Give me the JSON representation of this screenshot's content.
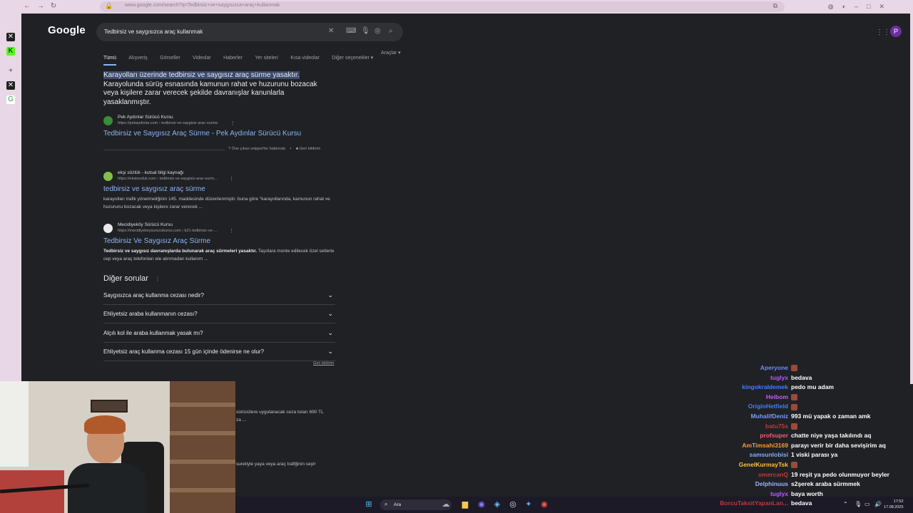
{
  "browser": {
    "url": "www.google.com/search?q=Tedbirsiz+ve+saygısızca+araç+kullanmak"
  },
  "google": {
    "logo": "Google",
    "query": "Tedbirsiz ve saygısızca araç kullanmak",
    "tabs": [
      "Tümü",
      "Alışveriş",
      "Görseller",
      "Videolar",
      "Haberler",
      "Yer siteleri",
      "Kısa videolar",
      "Diğer seçenekler"
    ],
    "tools": "Araçlar",
    "featured": {
      "highlight": "Karayolları üzerinde tedbirsiz ve saygısız araç sürme yasaktır.",
      "rest": "Karayolunda sürüş esnasında kamunun rahat ve huzurunu bozacak veya kişilere zarar verecek şekilde davranışlar kanunlarla yasaklanmıştır.",
      "site_name": "Pek Aydınlar Sürücü Kursu",
      "site_url": "https://pekaydinlar.com › tedbirsiz-ve-saygisiz-arac-surme",
      "title": "Tedbirsiz ve Saygısız Araç Sürme - Pek Aydınlar Sürücü Kursu",
      "about": "Öne çıkan snippet'ler hakkında",
      "feedback": "Geri bildirim"
    },
    "results": [
      {
        "site_name": "ekşi sözlük - kutsal bilgi kaynağı",
        "site_url": "https://eksisozluk.com › tedbirsiz-ve-saygisiz-arac-surm...",
        "title": "tedbirsiz ve saygısız araç sürme",
        "desc": "karayolları trafik yönetmeliğinin 145. maddesinde düzenlenmiştir. buna göre \"karayollarında, kamunun rahat ve huzurunu bozacak veya kişilere zarar verecek ..."
      },
      {
        "site_name": "Mecidiyeköy Sürücü Kursu",
        "site_url": "https://mecidiyekoysurucukursu.com › b21-tedbirsiz-ve-...",
        "title": "Tedbirsiz Ve Saygısız Araç Sürme",
        "desc_bold": "Tedbirsiz ve saygısız davranışlarda bulunarak araç sürmeleri yasaktır.",
        "desc": " Taşıtlara monte edilecek özel setlerle cep veya araç telefonları ele alınmadan kullanım ..."
      }
    ],
    "paa": {
      "title": "Diğer sorular",
      "questions": [
        "Saygısızca araç kullanma cezası nedir?",
        "Ehliyetsiz araba kullanmanın cezası?",
        "Alçılı kol ile araba kullanmak yasak mı?",
        "Ehliyetsiz araç kullanma cezası 15 gün içinde ödenirse ne olur?"
      ],
      "feedback": "Geri bildirim"
    },
    "partial": [
      "sürücülere uygulanacak ceza tutarı 690 TL",
      "za ...",
      "suretiyle yaya veya araç trafiğinin seyir"
    ]
  },
  "taskbar": {
    "search": "Ara",
    "time": "17:52",
    "date": "17.08.2025"
  },
  "chat": [
    {
      "user": "Aperyone",
      "color": "#6b8cff",
      "msg": "",
      "emote": true
    },
    {
      "user": "tuglyx",
      "color": "#b05cff",
      "msg": "bedava",
      "emote": false
    },
    {
      "user": "kingokraldemek",
      "color": "#3f7fff",
      "msg": "pedo mu adam",
      "emote": false
    },
    {
      "user": "Heibom",
      "color": "#c45cff",
      "msg": "",
      "emote": true
    },
    {
      "user": "OriginHetfield",
      "color": "#3f7fff",
      "msg": "",
      "emote": true
    },
    {
      "user": "MuhalifDeniz",
      "color": "#7a9cff",
      "msg": "993 mü yapak o zaman amk",
      "emote": false
    },
    {
      "user": "batu75s",
      "color": "#c0383c",
      "msg": "",
      "emote": true
    },
    {
      "user": "profsuper",
      "color": "#ff5577",
      "msg": "chatte niye yaşa takılındı aq",
      "emote": false
    },
    {
      "user": "AmTimsahi3169",
      "color": "#ff9a2e",
      "msg": "parayı verir bir daha sevişirim aq",
      "emote": false
    },
    {
      "user": "samsunlobisi",
      "color": "#7ab0ff",
      "msg": "1 viski parası ya",
      "emote": false
    },
    {
      "user": "GenelKurmayTsk",
      "color": "#ffc233",
      "msg": "",
      "emote": true
    },
    {
      "user": "omercanQ",
      "color": "#c0383c",
      "msg": "19 reşit ya pedo olunmuyor beyler",
      "emote": false
    },
    {
      "user": "Delphinuus",
      "color": "#9ab4ff",
      "msg": "s2şerek araba sürmmek",
      "emote": false
    },
    {
      "user": "tuglyx",
      "color": "#b05cff",
      "msg": "baya worth",
      "emote": false
    },
    {
      "user": "BorcuTaksitYapanLan...",
      "color": "#c0383c",
      "msg": "bedava",
      "emote": false
    }
  ]
}
